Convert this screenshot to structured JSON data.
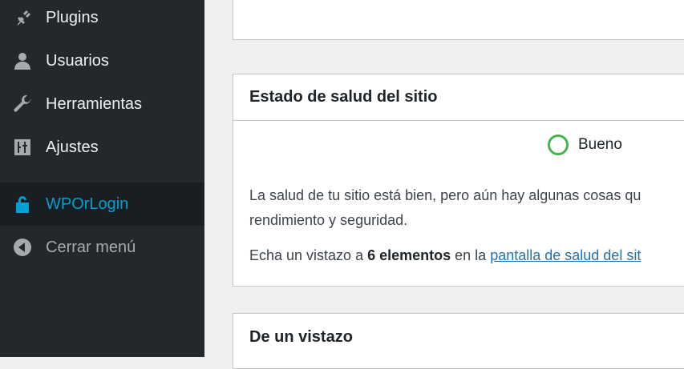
{
  "sidebar": {
    "items": [
      {
        "label": "Plugins",
        "icon": "plug-icon"
      },
      {
        "label": "Usuarios",
        "icon": "user-icon"
      },
      {
        "label": "Herramientas",
        "icon": "wrench-icon"
      },
      {
        "label": "Ajustes",
        "icon": "sliders-icon"
      },
      {
        "label": "WPOrLogin",
        "icon": "lock-icon",
        "active": true
      },
      {
        "label": "Cerrar menú",
        "icon": "collapse-arrow-icon"
      }
    ]
  },
  "site_health": {
    "title": "Estado de salud del sitio",
    "status": "Bueno",
    "description": "La salud de tu sitio está bien, pero aún hay algunas cosas qu",
    "description_cont": "rendimiento y seguridad.",
    "items_prefix": "Echa un vistazo a ",
    "items_count": "6 elementos",
    "items_mid": " en la ",
    "items_link": "pantalla de salud del sit"
  },
  "at_a_glance": {
    "title": "De un vistazo"
  },
  "colors": {
    "sidebar_bg": "#23282d",
    "active_accent": "#00a0d2",
    "status_good": "#46b450",
    "link": "#2271b1"
  }
}
